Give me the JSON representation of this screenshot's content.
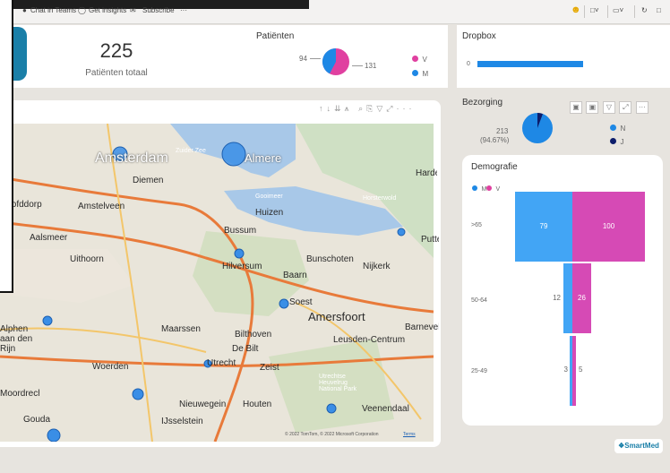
{
  "toolbar": {
    "items": [
      {
        "icon": "teams-icon",
        "label": "Chat in Teams"
      },
      {
        "icon": "lightbulb-icon",
        "label": "Get insights"
      },
      {
        "icon": "mail-icon",
        "label": "Subscribe"
      },
      {
        "icon": "more-icon",
        "label": "···"
      }
    ]
  },
  "kpi": {
    "value": "225",
    "label": "Patiënten totaal"
  },
  "patienten": {
    "title": "Patiënten",
    "left_value": "94",
    "right_value": "131",
    "legend": [
      {
        "label": "V",
        "color": "#e040a0"
      },
      {
        "label": "M",
        "color": "#1e88e5"
      }
    ]
  },
  "dropbox": {
    "title": "Dropbox",
    "axis_value": "0"
  },
  "bezorging": {
    "title": "Bezorging",
    "value": "213",
    "percent": "(94.67%)",
    "legend": [
      {
        "label": "N",
        "color": "#1e88e5"
      },
      {
        "label": "J",
        "color": "#0d1d6b"
      }
    ]
  },
  "demografie": {
    "title": "Demografie",
    "legend": [
      {
        "label": "M",
        "color": "#1e88e5"
      },
      {
        "label": "V",
        "color": "#e040a0"
      }
    ],
    "rows": [
      {
        "age": ">65",
        "m": "79",
        "v": "100"
      },
      {
        "age": "50-64",
        "m": "12",
        "v": "26"
      },
      {
        "age": "25-49",
        "m": "3",
        "v": "5"
      }
    ]
  },
  "map": {
    "places": [
      "Amsterdam",
      "Almere",
      "Diemen",
      "Zuider Zee",
      "Amstelveen",
      "Huizen",
      "Gooimeer",
      "Horsterwold",
      "Hoofddorp",
      "Aalsmeer",
      "Bussum",
      "Uithoorn",
      "Hilversum",
      "Bunschoten",
      "Nijkerk",
      "Baarn",
      "Soest",
      "Amersfoort",
      "Maarssen",
      "Bilthoven",
      "De Bilt",
      "Leusden-Centrum",
      "Woerden",
      "Utrecht",
      "Zeist",
      "Nieuwegein",
      "Houten",
      "IJsselstein",
      "Gouda",
      "Veenendaal",
      "Harderwijk",
      "Putten",
      "Barneveld",
      "Utrechtse Heuvelrug National Park",
      "Alphen aan den Rijn",
      "Moordrecht"
    ],
    "copyright": "© 2022 TomTom, © 2022 Microsoft Corporation",
    "terms": "Terms"
  },
  "brand": "SmartMed"
}
